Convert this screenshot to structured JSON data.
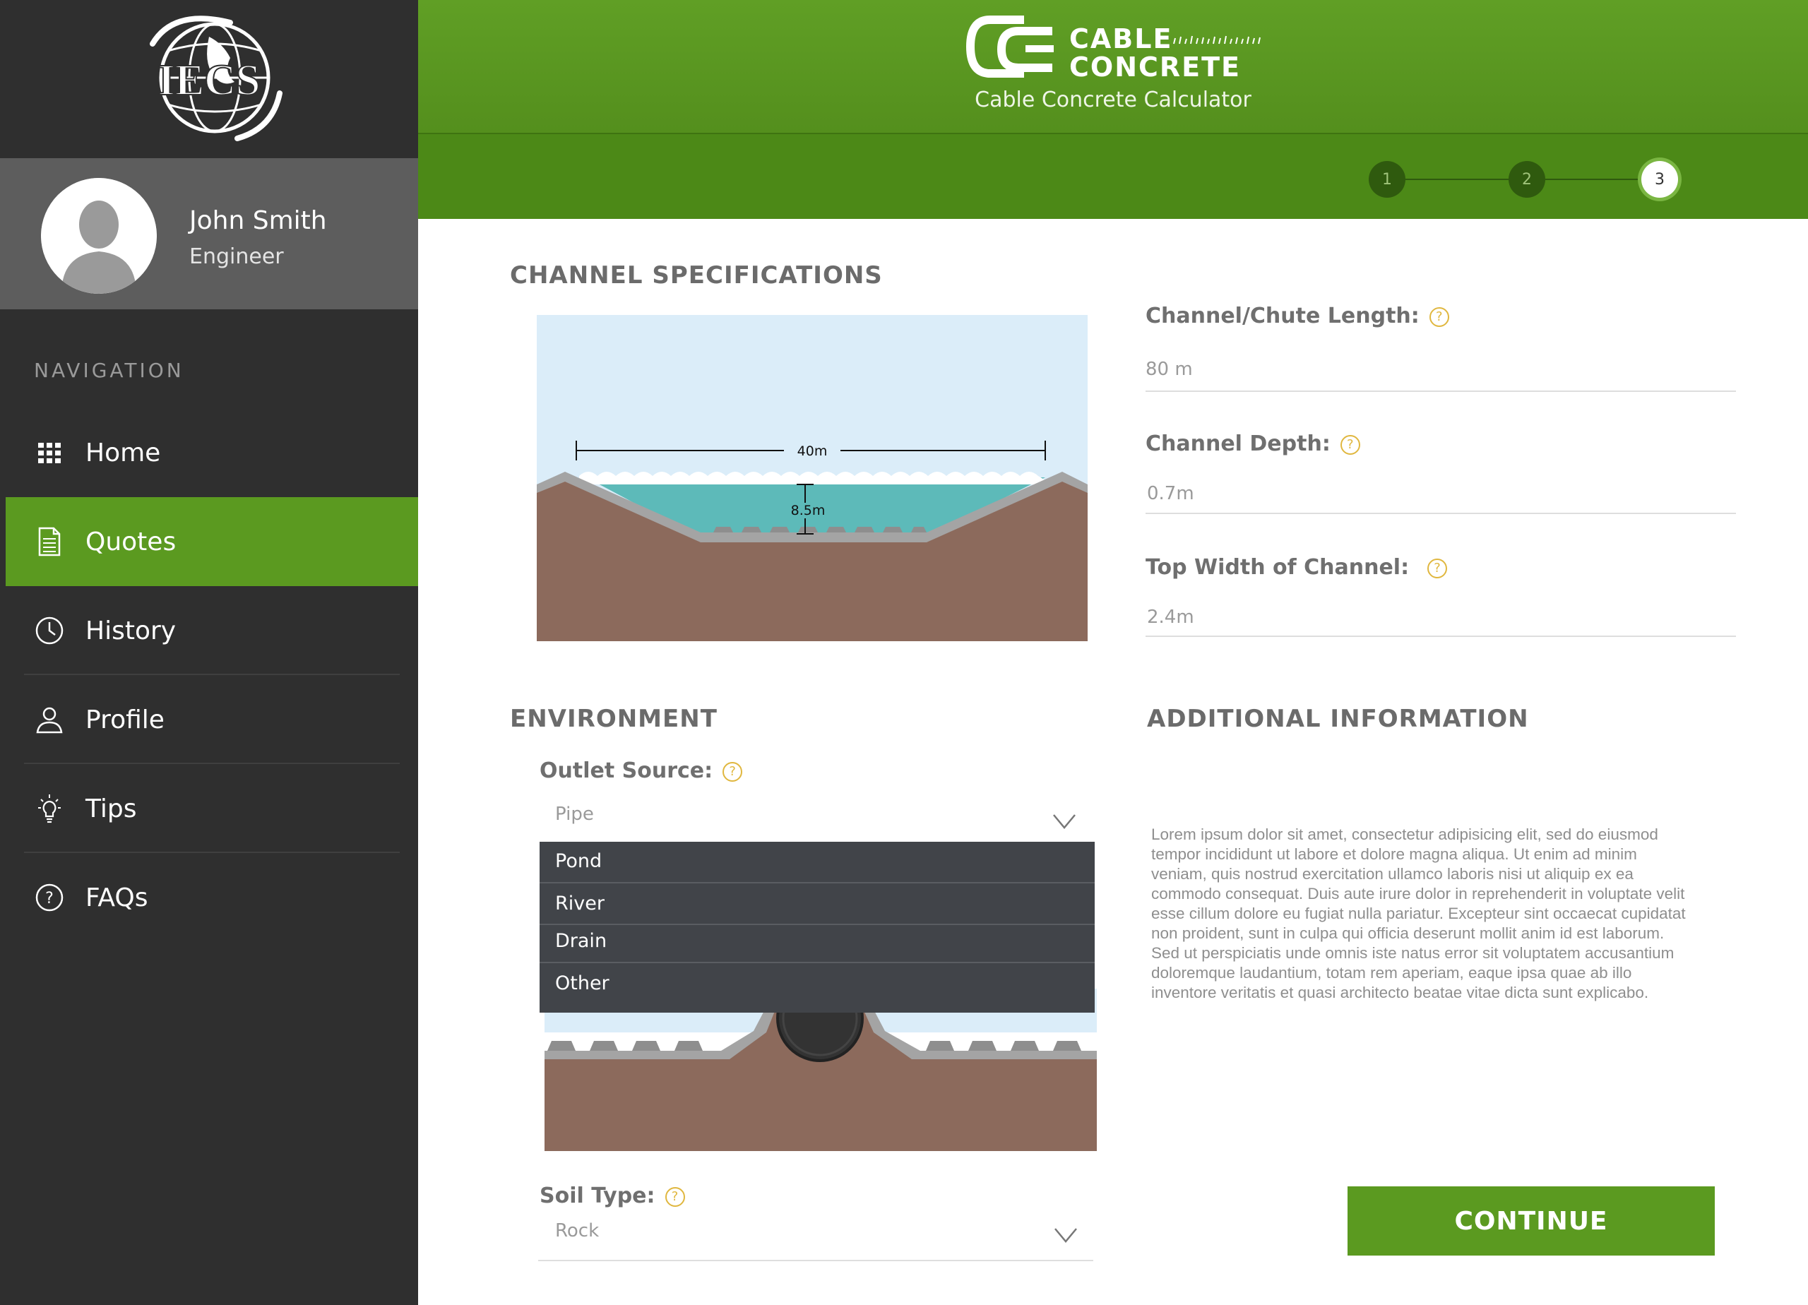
{
  "app": {
    "org_logo_text": "IECS",
    "brand_name_line1": "CABLE",
    "brand_name_line2": "CONCRETE",
    "header_subtitle": "Cable Concrete Calculator"
  },
  "user": {
    "name": "John Smith",
    "role": "Engineer"
  },
  "navigation": {
    "heading": "NAVIGATION",
    "items": [
      {
        "label": "Home",
        "icon": "grid-icon",
        "active": false
      },
      {
        "label": "Quotes",
        "icon": "document-icon",
        "active": true
      },
      {
        "label": "History",
        "icon": "clock-icon",
        "active": false
      },
      {
        "label": "Profile",
        "icon": "person-icon",
        "active": false
      },
      {
        "label": "Tips",
        "icon": "lightbulb-icon",
        "active": false
      },
      {
        "label": "FAQs",
        "icon": "question-circle-icon",
        "active": false
      }
    ]
  },
  "stepper": {
    "steps": [
      "1",
      "2",
      "3"
    ],
    "current_step": 3
  },
  "channel_specs": {
    "title": "CHANNEL SPECIFICATIONS",
    "diagram": {
      "width_label": "40m",
      "depth_label": "8.5m"
    },
    "fields": [
      {
        "label": "Channel/Chute Length:",
        "value": "80 m"
      },
      {
        "label": "Channel Depth:",
        "value": "0.7m"
      },
      {
        "label": "Top Width of Channel:",
        "value": "2.4m"
      }
    ],
    "help_glyph": "?"
  },
  "environment": {
    "title": "ENVIRONMENT",
    "outlet_source": {
      "label": "Outlet Source:",
      "selected": "Pipe",
      "options": [
        "Pond",
        "River",
        "Drain",
        "Other"
      ]
    },
    "soil_type": {
      "label": "Soil Type:",
      "selected": "Rock"
    }
  },
  "additional_info": {
    "title": "ADDITIONAL INFORMATION",
    "text": "Lorem ipsum dolor sit amet, consectetur adipisicing elit, sed do eiusmod tempor incididunt ut labore et dolore magna aliqua. Ut enim ad minim veniam, quis nostrud exercitation ullamco laboris nisi ut aliquip ex ea commodo consequat. Duis aute irure dolor in reprehenderit in voluptate velit esse cillum dolore eu fugiat nulla pariatur. Excepteur sint occaecat cupidatat non proident, sunt in culpa qui officia deserunt mollit anim id est laborum. Sed ut perspiciatis unde omnis iste natus error sit voluptatem accusantium doloremque laudantium, totam rem aperiam, eaque ipsa quae ab illo inventore veritatis et quasi architecto beatae vitae dicta sunt explicabo."
  },
  "actions": {
    "continue_label": "CONTINUE"
  },
  "colors": {
    "brand_green": "#5b9a20",
    "sidebar_bg": "#2f2f2f",
    "user_panel_bg": "#5d5d5d",
    "help_icon": "#e0b73f",
    "dropdown_bg": "#414449",
    "water": "#5dbab9",
    "soil": "#8c6a5c",
    "sky": "#dbedf9"
  }
}
